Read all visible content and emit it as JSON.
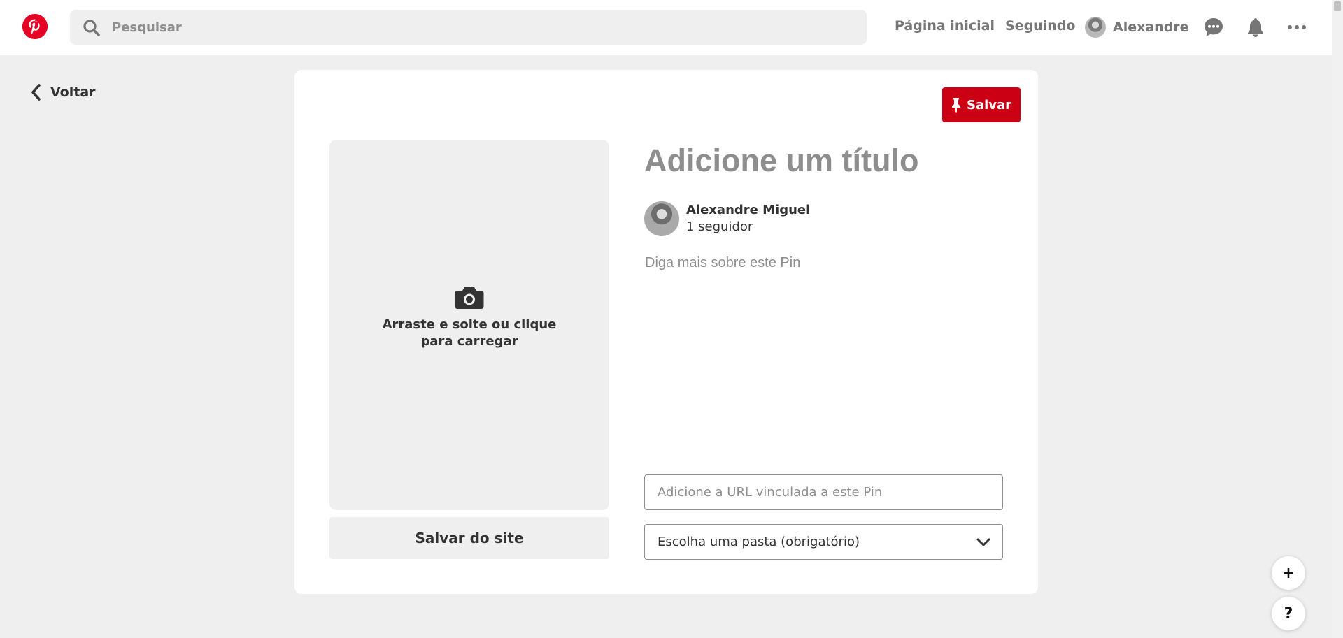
{
  "header": {
    "search_placeholder": "Pesquisar",
    "nav": {
      "home": "Página inicial",
      "following": "Seguindo",
      "user": "Alexandre"
    }
  },
  "back_label": "Voltar",
  "editor": {
    "save_label": "Salvar",
    "upload_text": "Arraste e solte ou clique para carregar",
    "save_from_site": "Salvar do site",
    "title_placeholder": "Adicione um título",
    "author": {
      "name": "Alexandre Miguel",
      "followers": "1 seguidor"
    },
    "description_placeholder": "Diga mais sobre este Pin",
    "url_placeholder": "Adicione a URL vinculada a este Pin",
    "board_select": "Escolha uma pasta (obrigatório)"
  },
  "fab": {
    "add": "+",
    "help": "?"
  },
  "colors": {
    "brand": "#e60023",
    "save_button": "#cc0014",
    "background": "#efefef"
  },
  "icons": [
    "pinterest-logo",
    "search-icon",
    "chat-icon",
    "bell-icon",
    "more-icon",
    "chevron-left-icon",
    "pin-icon",
    "camera-icon",
    "chevron-down-icon"
  ]
}
